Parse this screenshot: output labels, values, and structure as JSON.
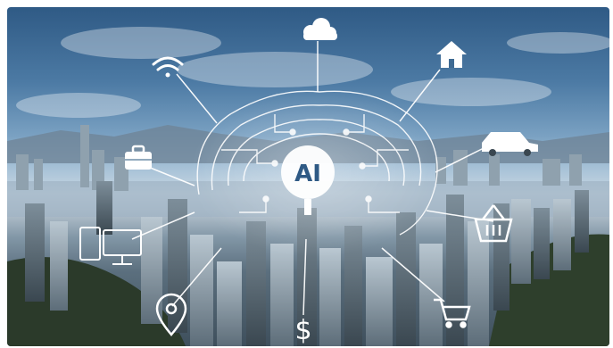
{
  "hero": {
    "center_label": "AI",
    "icons": [
      "cloud-icon",
      "wifi-icon",
      "house-icon",
      "briefcase-icon",
      "car-icon",
      "computer-icon",
      "shopping-basket-icon",
      "location-pin-icon",
      "dollar-icon",
      "shopping-cart-icon"
    ],
    "dollar_symbol": "$"
  }
}
